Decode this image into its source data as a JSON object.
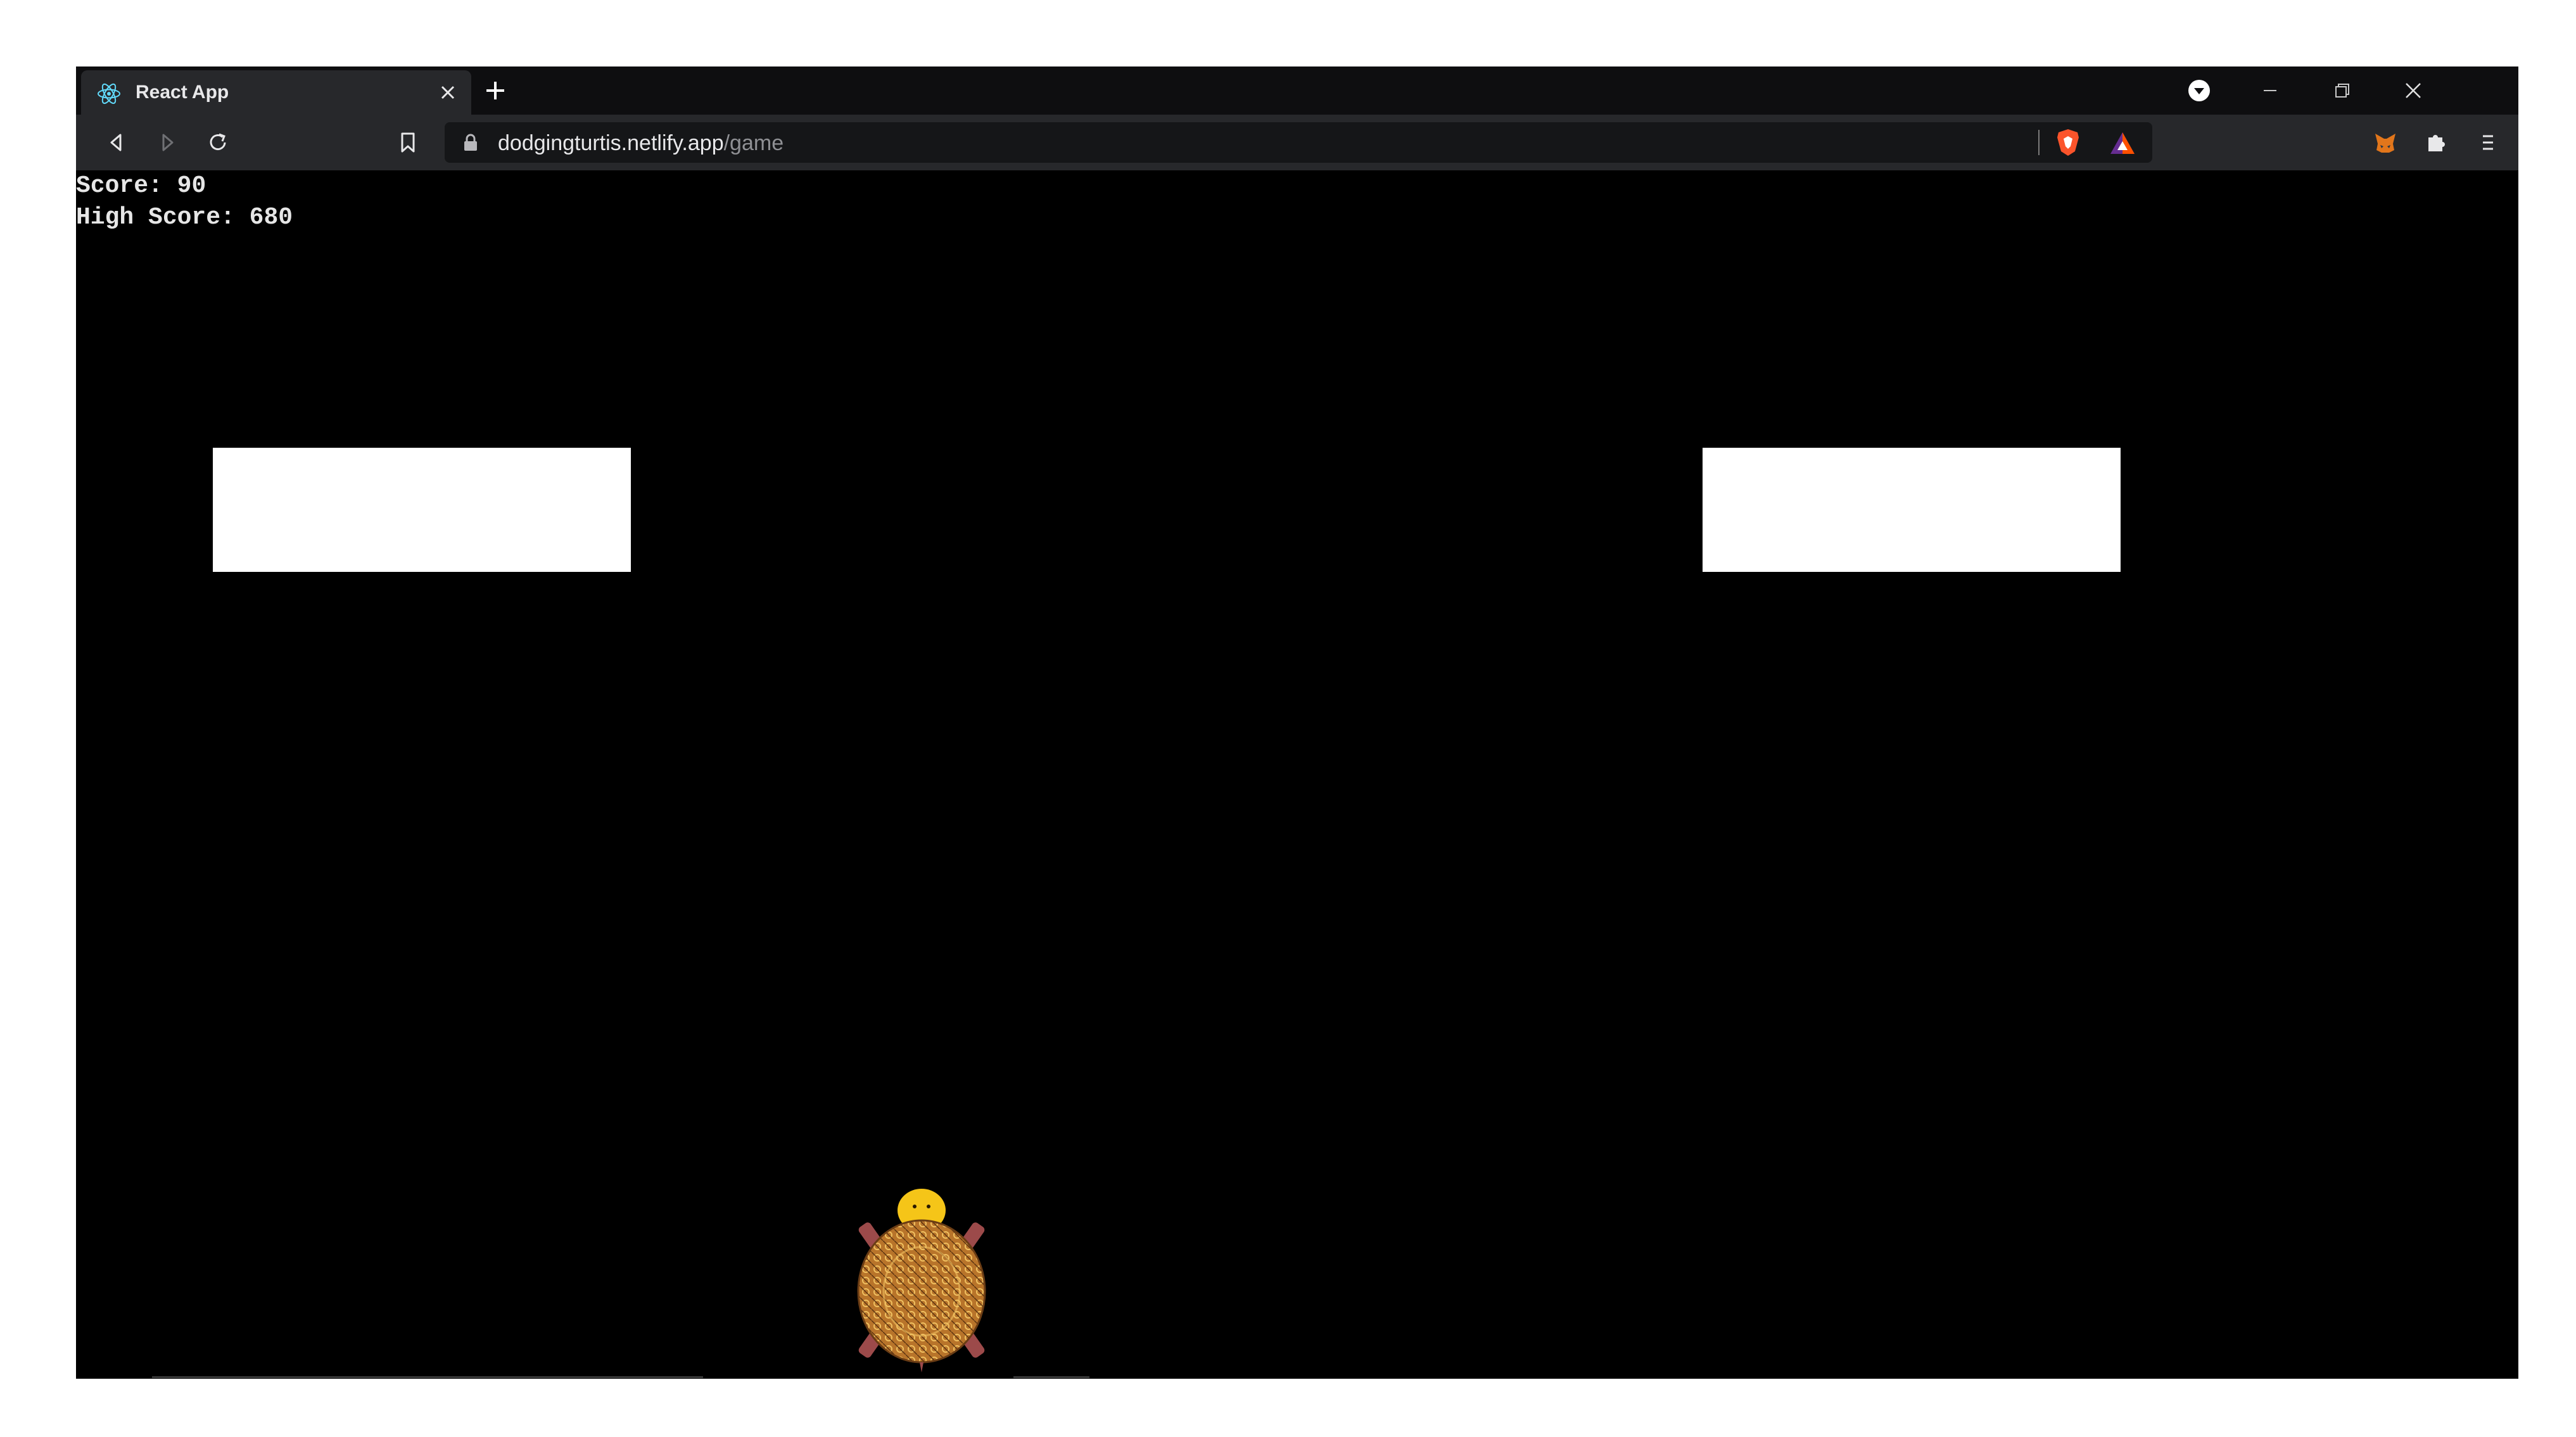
{
  "browser": {
    "tab_title": "React App",
    "url_host": "dodgingturtis.netlify.app",
    "url_path": "/game"
  },
  "game": {
    "score_label": "Score:",
    "score_value": "90",
    "high_score_label": "High Score:",
    "high_score_value": "680",
    "colors": {
      "background": "#000000",
      "block": "#ffffff",
      "hud_text": "#e6e6e6",
      "turtle_shell": "#b8742a",
      "turtle_head": "#f5c518",
      "turtle_legs": "#9c4a4a"
    }
  },
  "icons": [
    "react-icon",
    "close-icon",
    "plus-icon",
    "profile-dropdown-icon",
    "minimize-icon",
    "restore-icon",
    "window-close-icon",
    "back-icon",
    "forward-icon",
    "reload-icon",
    "bookmark-icon",
    "lock-icon",
    "brave-shields-icon",
    "brave-rewards-icon",
    "metamask-icon",
    "extensions-icon",
    "menu-icon"
  ]
}
